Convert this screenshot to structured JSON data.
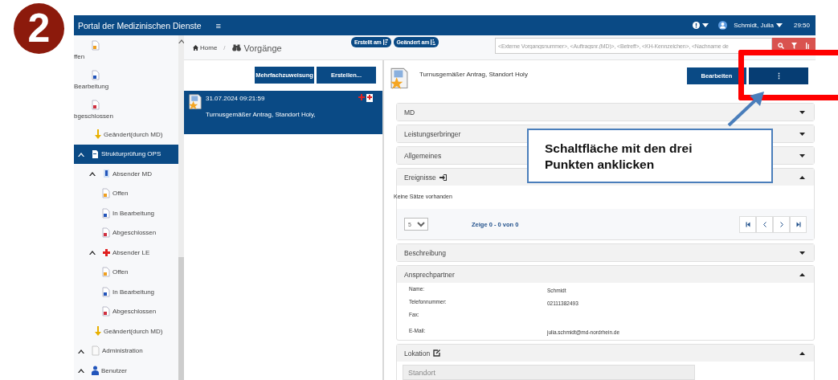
{
  "step_badge": "2",
  "header": {
    "title": "Portal der Medizinischen Dienste",
    "menu_glyph": "≡",
    "user": "Schmidt, Julia",
    "timer": "29:50"
  },
  "sidebar": {
    "previous_children": [
      {
        "label": "ffen",
        "kind": "open"
      },
      {
        "label": "Bearbeitung",
        "kind": "progress"
      },
      {
        "label": "bgeschlossen",
        "kind": "closed"
      }
    ],
    "previous_tail": {
      "label": "Geändert(durch MD)",
      "kind": "changed",
      "selected": false
    },
    "items": [
      {
        "label": "Strukturprüfung OPS",
        "kind": "folder",
        "selected": true,
        "expanded": true,
        "children": [
          {
            "label": "Absender MD",
            "kind": "md",
            "selected": false,
            "expanded": true,
            "children": [
              {
                "label": "Offen",
                "kind": "open",
                "selected": false
              },
              {
                "label": "In Bearbeitung",
                "kind": "progress",
                "selected": false
              },
              {
                "label": "Abgeschlossen",
                "kind": "closed",
                "selected": false
              }
            ]
          },
          {
            "label": "Absender LE",
            "kind": "le",
            "selected": false,
            "expanded": true,
            "children": [
              {
                "label": "Offen",
                "kind": "open",
                "selected": false
              },
              {
                "label": "In Bearbeitung",
                "kind": "progress",
                "selected": false
              },
              {
                "label": "Abgeschlossen",
                "kind": "closed",
                "selected": false
              }
            ]
          },
          {
            "label": "Geändert(durch MD)",
            "kind": "changed",
            "selected": false
          }
        ]
      },
      {
        "label": "Administration",
        "kind": "admin",
        "selected": false,
        "expanded": true
      },
      {
        "label": "Benutzer",
        "kind": "user",
        "selected": false,
        "expanded": true
      }
    ]
  },
  "breadcrumb": {
    "home": "Home",
    "separator": "/",
    "current": "Vorgänge"
  },
  "sort_buttons": [
    {
      "label": "Erstellt am",
      "kind": "desc"
    },
    {
      "label": "Geändert am",
      "kind": "asc"
    }
  ],
  "search": {
    "placeholder": "<Externe Vorgangsnummer>, <Auftragsnr.(MD)>, <Betreff>, <KH-Kennzeichen>, <Nachname de"
  },
  "list_actions": [
    "Mehrfachzuweisung",
    "Erstellen..."
  ],
  "cases": [
    {
      "date": "31.07.2024 09:21:59",
      "subject": "Turnusgemäßer Antrag, Standort Holy,",
      "selected": true
    }
  ],
  "detail": {
    "title": "Turnusgemäßer Antrag, Standort Holy",
    "actions": [
      "Bearbeiten",
      "⋮"
    ],
    "panels": [
      {
        "title": "MD",
        "kind": "plain",
        "expanded": false
      },
      {
        "title": "Leistungserbringer",
        "kind": "plain",
        "expanded": false
      },
      {
        "title": "Allgemeines",
        "kind": "plain",
        "expanded": false
      },
      {
        "title": "Ereignisse",
        "kind": "events",
        "expanded": true,
        "empty_text": "Keine Sätze vorhanden",
        "page_size": "5",
        "page_info": "Zeige 0 - 0 von 0"
      },
      {
        "title": "Beschreibung",
        "kind": "plain",
        "expanded": false
      },
      {
        "title": "Ansprechpartner",
        "kind": "contact",
        "expanded": true,
        "fields": [
          {
            "label": "Name:",
            "value": "Schmidt"
          },
          {
            "label": "Telefonnummer:",
            "value": "02111382493"
          },
          {
            "label": "Fax:"
          },
          {
            "label": "E-Mail:",
            "value": "julia.schmidt@md-nordrhein.de"
          }
        ]
      },
      {
        "title": "Lokation",
        "kind": "location",
        "expanded": true,
        "field_placeholder": "Standort"
      }
    ]
  },
  "callout": "Schaltfläche mit den drei Punkten anklicken"
}
